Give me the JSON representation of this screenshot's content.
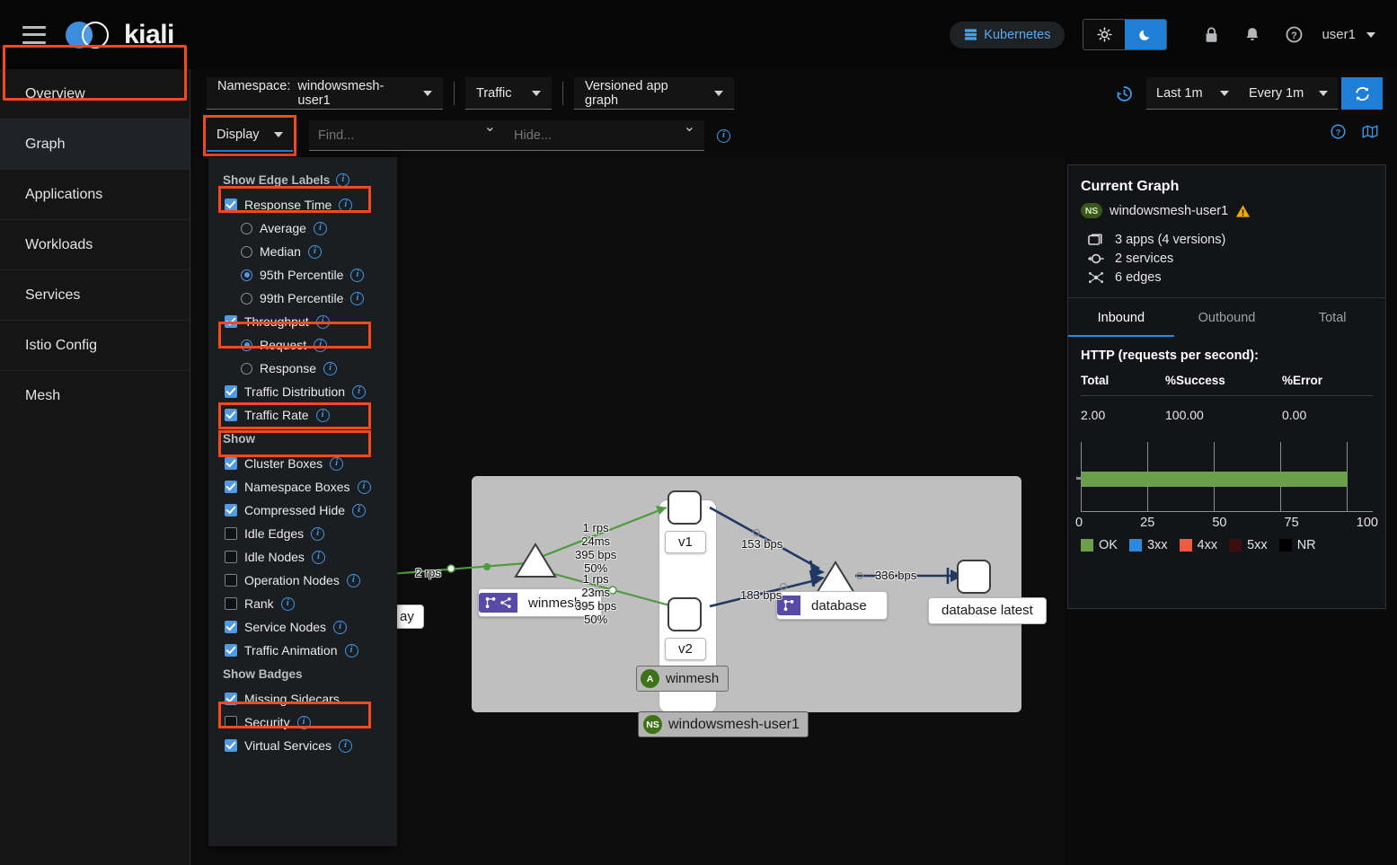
{
  "masthead": {
    "brand": "kiali",
    "menu_icon": "hamburger-icon",
    "kubernetes_label": "Kubernetes",
    "light_theme_icon": "sun-icon",
    "dark_theme_icon": "moon-icon",
    "lock_icon": "lock-icon",
    "bell_icon": "bell-icon",
    "help_icon": "question-circle-icon",
    "username": "user1"
  },
  "sidebar": {
    "items": [
      {
        "label": "Overview",
        "active": false
      },
      {
        "label": "Graph",
        "active": true
      },
      {
        "label": "Applications",
        "active": false
      },
      {
        "label": "Workloads",
        "active": false
      },
      {
        "label": "Services",
        "active": false
      },
      {
        "label": "Istio Config",
        "active": false
      },
      {
        "label": "Mesh",
        "active": false
      }
    ]
  },
  "toolbar": {
    "namespace_prefix": "Namespace:",
    "namespace_value": "windowsmesh-user1",
    "graph_type_value": "Traffic",
    "graph_layout_value": "Versioned app graph",
    "display_label": "Display",
    "find_placeholder": "Find...",
    "hide_placeholder": "Hide...",
    "history_icon": "history-icon",
    "duration_value": "Last 1m",
    "refresh_interval_value": "Every 1m",
    "refresh_icon": "sync-icon",
    "help_icon": "question-circle-icon",
    "legend_icon": "map-legend-icon"
  },
  "display_menu": {
    "edge_labels_title": "Show Edge Labels",
    "edge_labels": [
      {
        "label": "Response Time",
        "type": "checkbox",
        "checked": true,
        "info": true,
        "indent": false,
        "highlighted": true
      },
      {
        "label": "Average",
        "type": "radio",
        "checked": false,
        "info": true,
        "indent": true,
        "highlighted": false
      },
      {
        "label": "Median",
        "type": "radio",
        "checked": false,
        "info": true,
        "indent": true,
        "highlighted": false
      },
      {
        "label": "95th Percentile",
        "type": "radio",
        "checked": true,
        "info": true,
        "indent": true,
        "highlighted": false
      },
      {
        "label": "99th Percentile",
        "type": "radio",
        "checked": false,
        "info": true,
        "indent": true,
        "highlighted": false
      },
      {
        "label": "Throughput",
        "type": "checkbox",
        "checked": true,
        "info": true,
        "indent": false,
        "highlighted": true
      },
      {
        "label": "Request",
        "type": "radio",
        "checked": true,
        "info": true,
        "indent": true,
        "highlighted": false
      },
      {
        "label": "Response",
        "type": "radio",
        "checked": false,
        "info": true,
        "indent": true,
        "highlighted": false
      },
      {
        "label": "Traffic Distribution",
        "type": "checkbox",
        "checked": true,
        "info": true,
        "indent": false,
        "highlighted": true
      },
      {
        "label": "Traffic Rate",
        "type": "checkbox",
        "checked": true,
        "info": true,
        "indent": false,
        "highlighted": true
      }
    ],
    "show_title": "Show",
    "show_items": [
      {
        "label": "Cluster Boxes",
        "checked": true,
        "info": true,
        "highlighted": false
      },
      {
        "label": "Namespace Boxes",
        "checked": true,
        "info": true,
        "highlighted": false
      },
      {
        "label": "Compressed Hide",
        "checked": true,
        "info": true,
        "highlighted": false
      },
      {
        "label": "Idle Edges",
        "checked": false,
        "info": true,
        "highlighted": false
      },
      {
        "label": "Idle Nodes",
        "checked": false,
        "info": true,
        "highlighted": false
      },
      {
        "label": "Operation Nodes",
        "checked": false,
        "info": true,
        "highlighted": false
      },
      {
        "label": "Rank",
        "checked": false,
        "info": true,
        "highlighted": false
      },
      {
        "label": "Service Nodes",
        "checked": true,
        "info": true,
        "highlighted": false
      },
      {
        "label": "Traffic Animation",
        "checked": true,
        "info": true,
        "highlighted": true
      }
    ],
    "badges_title": "Show Badges",
    "badge_items": [
      {
        "label": "Missing Sidecars",
        "checked": true,
        "info": false,
        "highlighted": false
      },
      {
        "label": "Security",
        "checked": false,
        "info": true,
        "highlighted": false
      },
      {
        "label": "Virtual Services",
        "checked": true,
        "info": true,
        "highlighted": false
      }
    ]
  },
  "graph": {
    "namespace_badge_letters": "NS",
    "namespace_name": "windowsmesh-user1",
    "app_badge_letters": "A",
    "app_group_name": "winmesh",
    "nodes": [
      {
        "name": "winmesh",
        "kind": "service",
        "badges": [
          "virtual-service-icon",
          "traffic-shifting-icon"
        ]
      },
      {
        "name": "v1",
        "kind": "version"
      },
      {
        "name": "v2",
        "kind": "version"
      },
      {
        "name": "database",
        "kind": "service",
        "badges": [
          "virtual-service-icon"
        ]
      },
      {
        "name": "database latest",
        "kind": "workload"
      }
    ],
    "clipped_node_label": "ay",
    "edges": [
      {
        "label": "2 rps"
      },
      {
        "label": "1 rps\n24ms\n395 bps\n50%"
      },
      {
        "label": "1 rps\n23ms\n395 bps\n50%"
      },
      {
        "label": "153 bps"
      },
      {
        "label": "183 bps"
      },
      {
        "label": "336 bps"
      }
    ],
    "edge_labels": {
      "ingress_rps": "2 rps",
      "v1_rps": "1 rps",
      "v1_rt": "24ms",
      "v1_bps": "395 bps",
      "v1_pct": "50%",
      "v2_rps": "1 rps",
      "v2_rt": "23ms",
      "v2_bps": "395 bps",
      "v2_pct": "50%",
      "v1_db": "153 bps",
      "v2_db": "183 bps",
      "db_latest": "336 bps"
    }
  },
  "side_panel": {
    "title": "Current Graph",
    "ns_badge": "NS",
    "ns_name": "windowsmesh-user1",
    "warning_icon": "warning-triangle-icon",
    "stats": [
      {
        "icon": "applications-icon",
        "text": "3 apps (4 versions)"
      },
      {
        "icon": "services-icon",
        "text": "2 services"
      },
      {
        "icon": "edges-icon",
        "text": "6 edges"
      }
    ],
    "tabs": [
      {
        "label": "Inbound",
        "active": true
      },
      {
        "label": "Outbound",
        "active": false
      },
      {
        "label": "Total",
        "active": false
      }
    ],
    "http_title": "HTTP (requests per second):",
    "table": {
      "headers": [
        "Total",
        "%Success",
        "%Error"
      ],
      "rows": [
        [
          "2.00",
          "100.00",
          "0.00"
        ]
      ]
    },
    "chart_data": {
      "type": "bar",
      "title": "HTTP (requests per second):",
      "categories": [
        "OK",
        "3xx",
        "4xx",
        "5xx",
        "NR"
      ],
      "values": [
        100,
        0,
        0,
        0,
        0
      ],
      "xlabel": "",
      "ylabel": "",
      "xlim": [
        0,
        100
      ],
      "ticks": [
        "0",
        "25",
        "50",
        "75",
        "100"
      ],
      "grid": true,
      "legend_position": "bottom",
      "colors": {
        "OK": "#6aa04a",
        "3xx": "#2b8ae0",
        "4xx": "#ef5c42",
        "5xx": "#3c0d0d",
        "NR": "#000000"
      }
    },
    "legend": [
      {
        "label": "OK",
        "color": "#6aa04a"
      },
      {
        "label": "3xx",
        "color": "#2b8ae0"
      },
      {
        "label": "4xx",
        "color": "#ef5c42"
      },
      {
        "label": "5xx",
        "color": "#3c0d0d"
      },
      {
        "label": "NR",
        "color": "#000000"
      }
    ]
  },
  "colors": {
    "accent_blue": "#1f7fd6",
    "highlight_orange": "#f4481e",
    "ok_green": "#6aa04a",
    "graph_edge_green": "#4e9a3f",
    "graph_edge_navy": "#1f3864"
  }
}
